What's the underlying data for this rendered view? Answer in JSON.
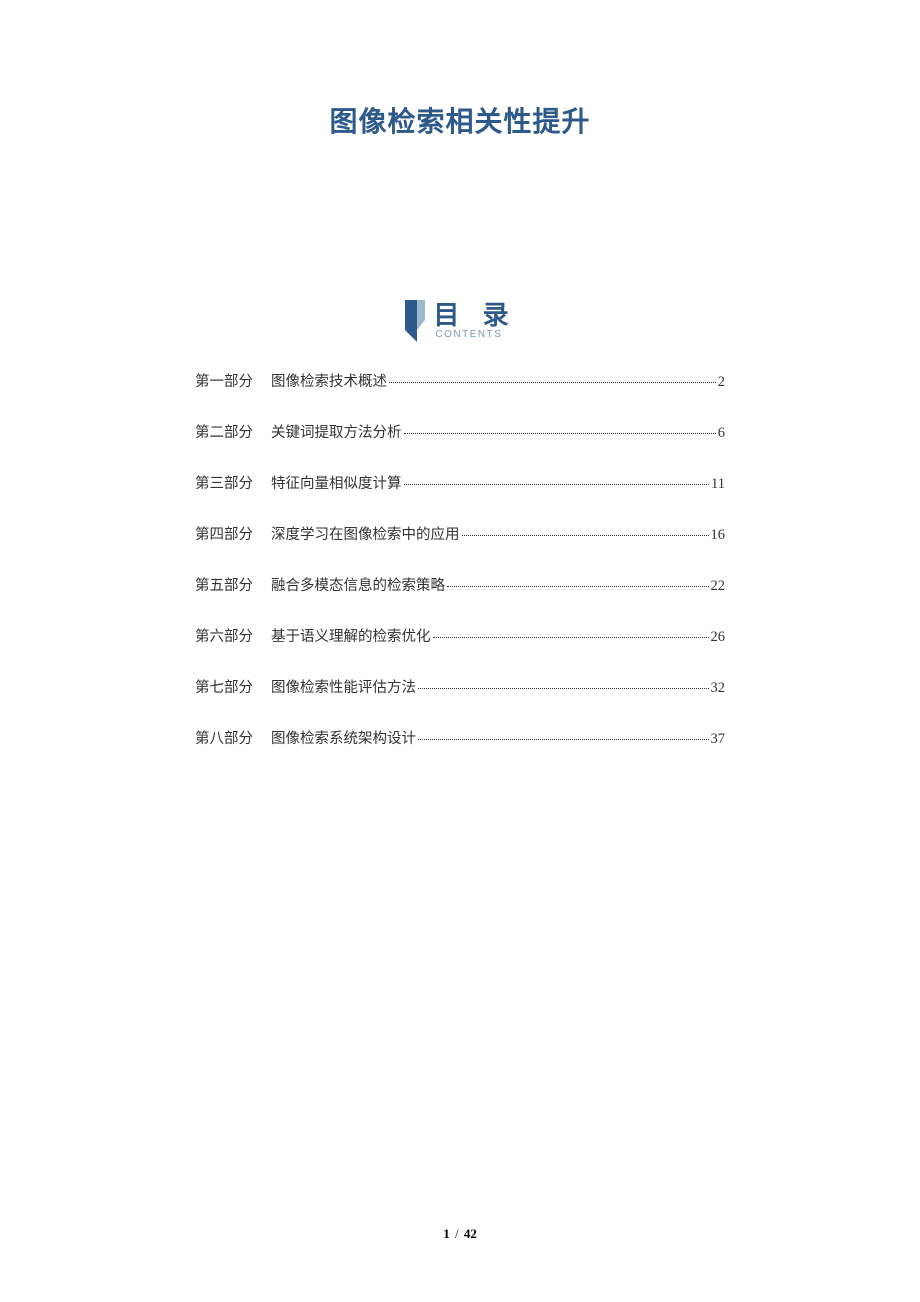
{
  "title": "图像检索相关性提升",
  "toc_header": {
    "cn": "目 录",
    "en": "CONTENTS"
  },
  "toc": [
    {
      "part": "第一部分",
      "chapter": "图像检索技术概述",
      "page": "2"
    },
    {
      "part": "第二部分",
      "chapter": "关键词提取方法分析",
      "page": "6"
    },
    {
      "part": "第三部分",
      "chapter": "特征向量相似度计算",
      "page": "11"
    },
    {
      "part": "第四部分",
      "chapter": "深度学习在图像检索中的应用",
      "page": "16"
    },
    {
      "part": "第五部分",
      "chapter": "融合多模态信息的检索策略",
      "page": "22"
    },
    {
      "part": "第六部分",
      "chapter": "基于语义理解的检索优化",
      "page": "26"
    },
    {
      "part": "第七部分",
      "chapter": "图像检索性能评估方法",
      "page": "32"
    },
    {
      "part": "第八部分",
      "chapter": "图像检索系统架构设计",
      "page": "37"
    }
  ],
  "footer": {
    "current": "1",
    "sep": "/",
    "total": "42"
  }
}
